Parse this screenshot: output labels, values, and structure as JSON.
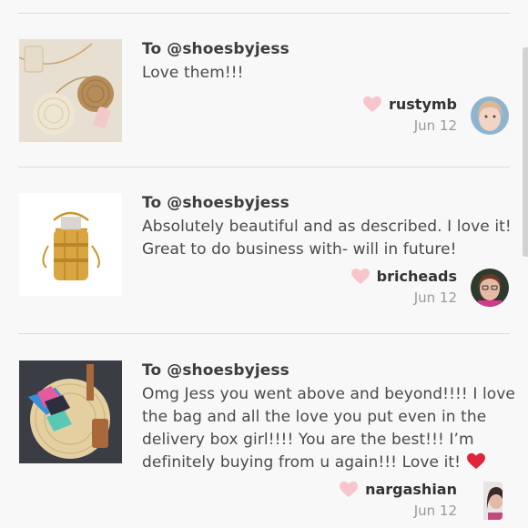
{
  "reviews": [
    {
      "to": "To @shoesbyjess",
      "message": "Love them!!!",
      "username": "rustymb",
      "date": "Jun 12",
      "thumbnail_icon": "round-straw-bags-photo"
    },
    {
      "to": "To @shoesbyjess",
      "message": "Absolutely beautiful and as described. I love it! Great to do business with- will in future!",
      "username": "bricheads",
      "date": "Jun 12",
      "thumbnail_icon": "bucket-bag-photo"
    },
    {
      "to": "To @shoesbyjess",
      "message": "Omg Jess you went above and beyond!!!! I love the bag and all the love you put even in the delivery box girl!!!! You are the best!!! I’m definitely buying from u again!!! Love it!",
      "message_emoji": "red-heart-emoji",
      "username": "nargashian",
      "date": "Jun 12",
      "thumbnail_icon": "round-rattan-bag-photo"
    }
  ],
  "colors": {
    "background": "#f9f8f8",
    "divider": "#dcdcdc",
    "heart_like": "#f7c6cc",
    "heart_emoji": "#e0243a",
    "date_text": "#999999"
  }
}
